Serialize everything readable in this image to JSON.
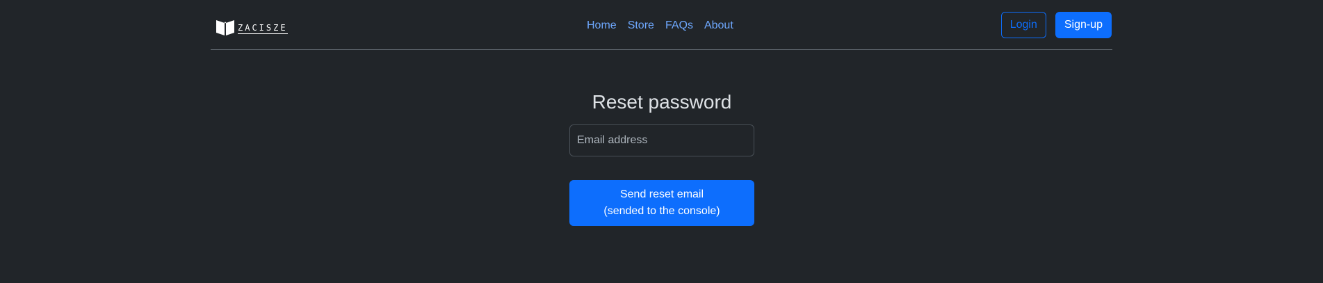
{
  "brand": {
    "name": "ZACISZE",
    "icon": "open-book-icon"
  },
  "nav": {
    "items": [
      {
        "label": "Home"
      },
      {
        "label": "Store"
      },
      {
        "label": "FAQs"
      },
      {
        "label": "About"
      }
    ]
  },
  "auth": {
    "login_label": "Login",
    "signup_label": "Sign-up"
  },
  "reset": {
    "title": "Reset password",
    "email_placeholder": "Email address",
    "email_value": "",
    "submit_line1": "Send reset email",
    "submit_line2": "(sended to the console)"
  },
  "colors": {
    "background": "#212529",
    "primary": "#0d6efd",
    "link": "#6ea8fe",
    "text": "#dee2e6",
    "divider": "#6c757d"
  }
}
